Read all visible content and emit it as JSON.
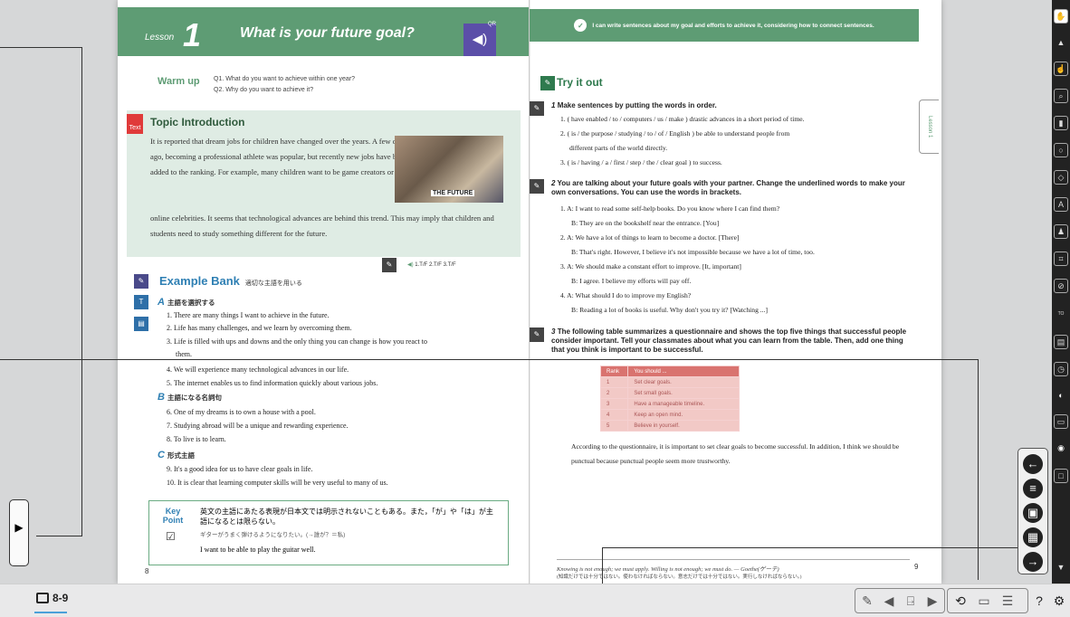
{
  "left_page": {
    "lesson_label": "Lesson",
    "lesson_number": "1",
    "title": "What is your future goal?",
    "qr_label": "QR",
    "warm_up": {
      "label": "Warm up",
      "q1": "Q1. What do you want to achieve within one year?",
      "q2": "Q2. Why do you want to achieve it?"
    },
    "topic": {
      "heading": "Topic Introduction",
      "icon_label": "Text",
      "text1": "It is reported that dream jobs for children have changed over the years. A few decades ago, becoming a professional athlete was popular, but recently new jobs have been added to the ranking. For example, many children want to be game creators or become",
      "text2": "online celebrities. It seems that technological advances are behind this trend. This may imply that children and students need to study something different for the future.",
      "photo_caption": "THE FUTURE",
      "audio_label": "1.T/F  2.T/F  3.T/F"
    },
    "example_bank": {
      "heading": "Example Bank",
      "sub": "適切な主語を用いる",
      "sec_a": {
        "letter": "A",
        "title": "主語を選択する"
      },
      "a_lines": [
        "1. There are many things I want to achieve in the future.",
        "2. Life has many challenges, and we learn by overcoming them.",
        "3. Life is filled with ups and downs and the only thing you can change is how you react to",
        "them.",
        "4. We will experience many technological advances in our life.",
        "5. The internet enables us to find information quickly about various jobs."
      ],
      "sec_b": {
        "letter": "B",
        "title": "主語になる名詞句"
      },
      "b_lines": [
        "6. One of my dreams is to own a house with a pool.",
        "7. Studying abroad will be a unique and rewarding experience.",
        "8. To live is to learn."
      ],
      "sec_c": {
        "letter": "C",
        "title": "形式主語"
      },
      "c_lines": [
        "9. It's a good idea for us to have clear goals in life.",
        "10. It is clear that learning computer skills will be very useful to many of us."
      ]
    },
    "key_point": {
      "label": "Key Point",
      "line1": "英文の主語にあたる表現が日本文では明示されないこともある。また，「が」や「は」が主語になるとは限らない。",
      "line2": "ギターがうまく弾けるようになりたい。(→誰が？＝私)",
      "line3": "I want to be able to play the guitar well."
    },
    "page_number": "8"
  },
  "right_page": {
    "can_do": "I can write sentences about my goal and efforts to achieve it, considering how to connect sentences.",
    "side_tab": "Lesson 1",
    "try_heading": "Try it out",
    "q1": {
      "num": "1",
      "title": "Make sentences by putting the words in order.",
      "lines": [
        "1. ( have enabled / to / computers / us / make ) drastic advances in a short period of time.",
        "2. ( is / the purpose / studying / to / of / English ) be able to understand people from",
        "different parts of the world directly.",
        "3. ( is / having / a / first / step / the / clear goal ) to success."
      ]
    },
    "q2": {
      "num": "2",
      "title": "You are talking about your future goals with your partner. Change the underlined words to make your own conversations. You can use the words in brackets.",
      "lines": [
        "1. A: I want to read some self-help books. Do you know where I can find them?",
        "B: They are on the bookshelf near the entrance. [You]",
        "2. A: We have a lot of things to learn to become a doctor. [There]",
        "B: That's right. However, I believe it's not impossible because we have a lot of time, too.",
        "3. A: We should make a constant effort to improve. [It, important]",
        "B: I agree. I believe my efforts will pay off.",
        "4. A: What should I do to improve my English?",
        "B: Reading a lot of books is useful. Why don't you try it? [Watching ...]"
      ]
    },
    "q3": {
      "num": "3",
      "title": "The following table summarizes a questionnaire and shows the top five things that successful people consider important. Tell your classmates about what you can learn from the table. Then, add one thing that you think is important to be successful."
    },
    "table": {
      "headers": [
        "Rank",
        "You should ..."
      ],
      "rows": [
        [
          "1",
          "Set clear goals."
        ],
        [
          "2",
          "Set small goals."
        ],
        [
          "3",
          "Have a manageable timeline."
        ],
        [
          "4",
          "Keep an open mind."
        ],
        [
          "5",
          "Believe in yourself."
        ]
      ]
    },
    "answer": "According to the questionnaire, it is important to set clear goals to become successful. In addition, I think we should be punctual because punctual people seem more trustworthy.",
    "quote": "Knowing is not enough; we must apply. Willing is not enough; we must do. — Goethe(ゲーテ)",
    "quote_jp": "(知識だけでは十分ではない。使わなければならない。意志だけでは十分ではない。実行しなければならない。)",
    "page_number": "9"
  },
  "bottom_bar": {
    "page_range": "8-9"
  },
  "colors": {
    "green": "#5e9c74",
    "blue": "#2e7fb3",
    "table_head": "#d9736f",
    "bar": "#e9e9ea"
  }
}
